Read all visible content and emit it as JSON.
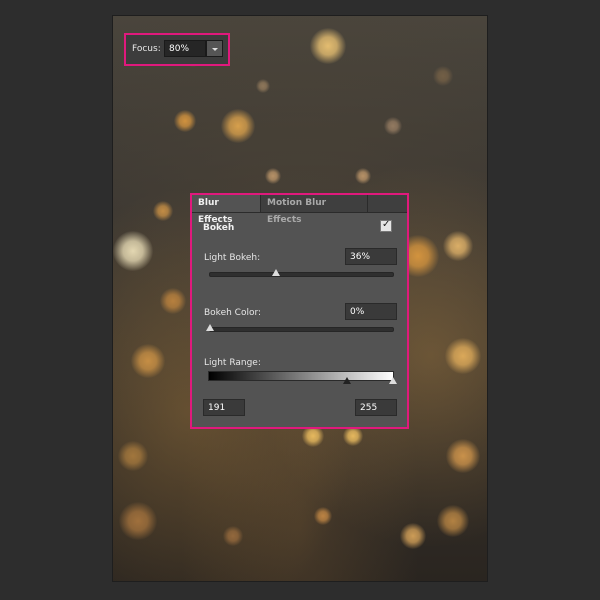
{
  "focus": {
    "label": "Focus:",
    "value": "80%"
  },
  "panel": {
    "tabs": [
      {
        "label": "Blur Effects",
        "active": true
      },
      {
        "label": "Motion Blur Effects",
        "active": false
      }
    ],
    "section_title": "Bokeh",
    "bokeh_enabled": true,
    "light_bokeh": {
      "label": "Light Bokeh:",
      "value": "36%",
      "level": 0.36
    },
    "bokeh_color": {
      "label": "Bokeh Color:",
      "value": "0%",
      "level": 0.0
    },
    "light_range": {
      "label": "Light Range:",
      "min_value": "191",
      "max_value": "255",
      "min_level": 191,
      "max_level": 255
    }
  },
  "colors": {
    "highlight_border": "#e0197d",
    "panel_bg": "#535353",
    "app_bg": "#2d2d2d"
  },
  "icons": {
    "dropdown": "chevron-down-icon",
    "checkbox": "checkmark-icon"
  }
}
